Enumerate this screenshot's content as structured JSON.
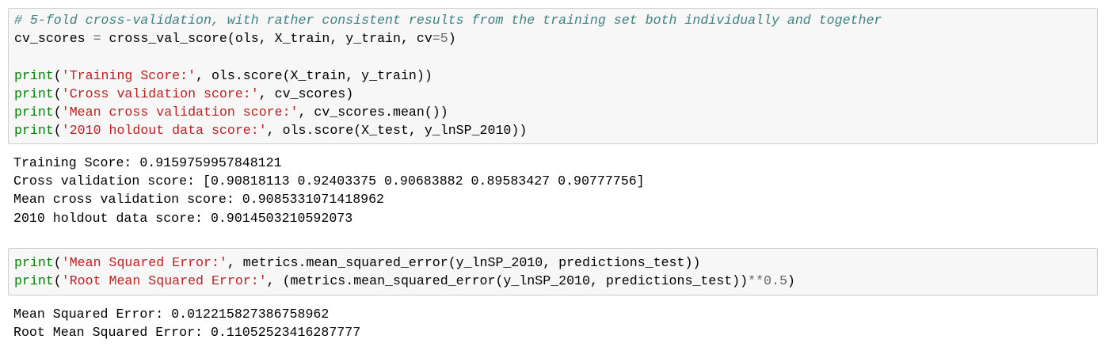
{
  "cells": [
    {
      "input_lines": [
        [
          {
            "t": "# 5-fold cross-validation, with rather consistent results from the training set both individually and together",
            "c": "cmt"
          }
        ],
        [
          {
            "t": "cv_scores ",
            "c": "txt"
          },
          {
            "t": "=",
            "c": "op"
          },
          {
            "t": " cross_val_score(ols, X_train, y_train, cv",
            "c": "txt"
          },
          {
            "t": "=",
            "c": "op"
          },
          {
            "t": "5",
            "c": "num"
          },
          {
            "t": ")",
            "c": "txt"
          }
        ],
        [],
        [
          {
            "t": "print",
            "c": "bi"
          },
          {
            "t": "(",
            "c": "txt"
          },
          {
            "t": "'Training Score:'",
            "c": "str"
          },
          {
            "t": ", ols.score(X_train, y_train))",
            "c": "txt"
          }
        ],
        [
          {
            "t": "print",
            "c": "bi"
          },
          {
            "t": "(",
            "c": "txt"
          },
          {
            "t": "'Cross validation score:'",
            "c": "str"
          },
          {
            "t": ", cv_scores)",
            "c": "txt"
          }
        ],
        [
          {
            "t": "print",
            "c": "bi"
          },
          {
            "t": "(",
            "c": "txt"
          },
          {
            "t": "'Mean cross validation score:'",
            "c": "str"
          },
          {
            "t": ", cv_scores.mean())",
            "c": "txt"
          }
        ],
        [
          {
            "t": "print",
            "c": "bi"
          },
          {
            "t": "(",
            "c": "txt"
          },
          {
            "t": "'2010 holdout data score:'",
            "c": "str"
          },
          {
            "t": ", ols.score(X_test, y_lnSP_2010))",
            "c": "txt"
          }
        ]
      ],
      "output_lines": [
        "Training Score: 0.9159759957848121",
        "Cross validation score: [0.90818113 0.92403375 0.90683882 0.89583427 0.90777756]",
        "Mean cross validation score: 0.9085331071418962",
        "2010 holdout data score: 0.9014503210592073"
      ]
    },
    {
      "input_lines": [
        [
          {
            "t": "print",
            "c": "bi"
          },
          {
            "t": "(",
            "c": "txt"
          },
          {
            "t": "'Mean Squared Error:'",
            "c": "str"
          },
          {
            "t": ", metrics.mean_squared_error(y_lnSP_2010, predictions_test))",
            "c": "txt"
          }
        ],
        [
          {
            "t": "print",
            "c": "bi"
          },
          {
            "t": "(",
            "c": "txt"
          },
          {
            "t": "'Root Mean Squared Error:'",
            "c": "str"
          },
          {
            "t": ", (metrics.mean_squared_error(y_lnSP_2010, predictions_test))",
            "c": "txt"
          },
          {
            "t": "**",
            "c": "op"
          },
          {
            "t": "0.5",
            "c": "num"
          },
          {
            "t": ")",
            "c": "txt"
          }
        ]
      ],
      "output_lines": [
        "Mean Squared Error: 0.012215827386758962",
        "Root Mean Squared Error: 0.11052523416287777"
      ]
    }
  ]
}
